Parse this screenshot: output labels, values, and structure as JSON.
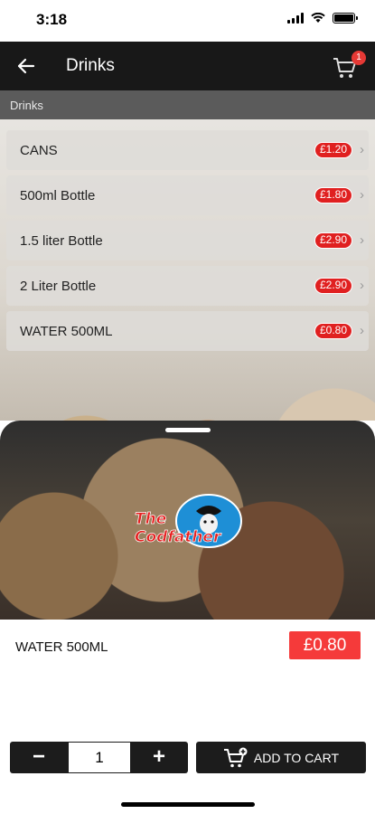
{
  "status_bar": {
    "time": "3:18"
  },
  "app_bar": {
    "title": "Drinks",
    "back_icon": "arrow-left-icon",
    "cart_icon": "cart-icon",
    "cart_count": "1"
  },
  "section": {
    "header": "Drinks"
  },
  "items": [
    {
      "name": "CANS",
      "price": "£1.20"
    },
    {
      "name": "500ml Bottle",
      "price": "£1.80"
    },
    {
      "name": "1.5 liter Bottle",
      "price": "£2.90"
    },
    {
      "name": "2 Liter Bottle",
      "price": "£2.90"
    },
    {
      "name": "WATER 500ML",
      "price": "£0.80"
    }
  ],
  "logo": {
    "line1": "The",
    "line2": "Codfather"
  },
  "detail": {
    "name": "WATER 500ML",
    "price": "£0.80"
  },
  "quantity": {
    "minus": "−",
    "value": "1",
    "plus": "+"
  },
  "add_to_cart": {
    "label": "ADD TO CART",
    "icon": "cart-plus-icon"
  },
  "colors": {
    "accent_red": "#f53a3a",
    "bar_dark": "#181818",
    "button_dark": "#1c1c1c"
  }
}
